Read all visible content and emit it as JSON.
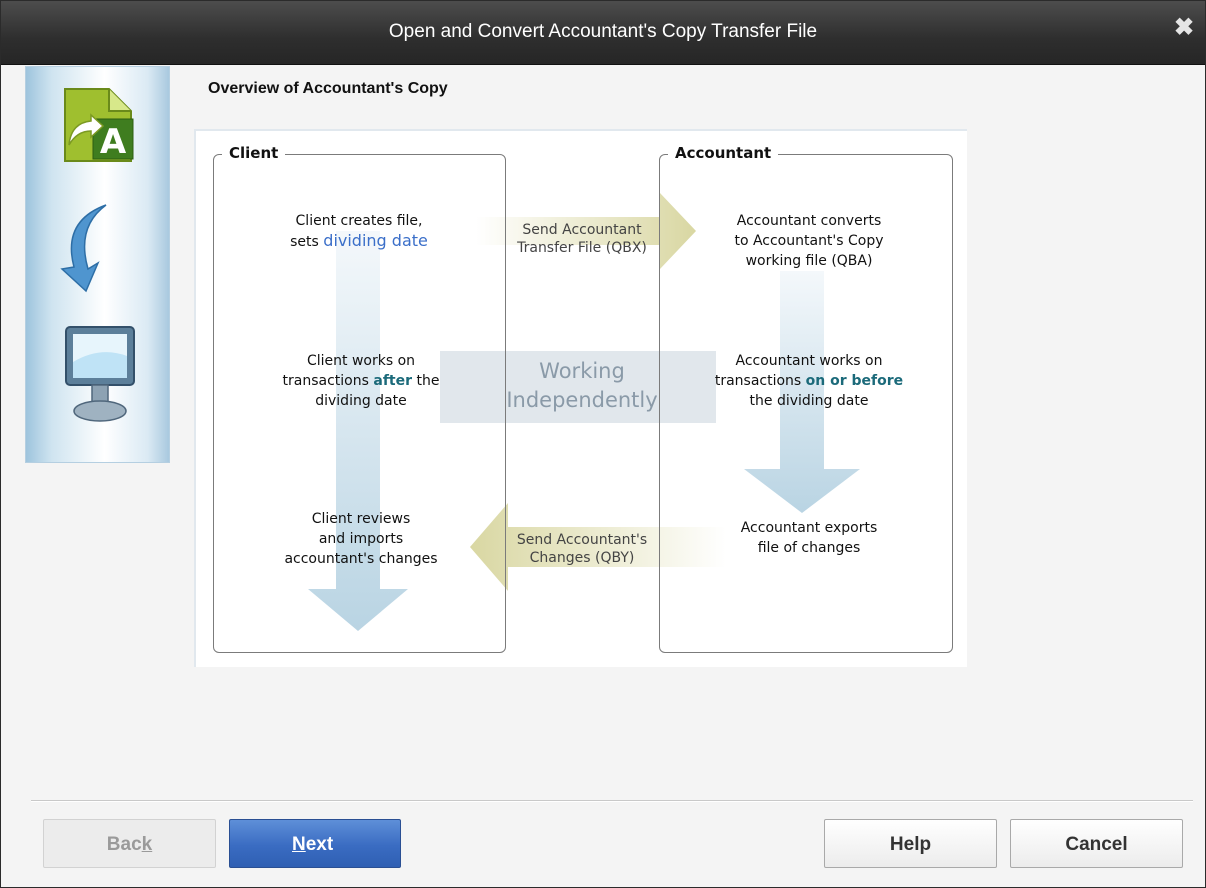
{
  "window": {
    "title": "Open and Convert Accountant's Copy Transfer File",
    "close_glyph": "✖"
  },
  "sidebar": {
    "icons": [
      "accountant-copy-icon",
      "curved-arrow-icon",
      "monitor-icon"
    ]
  },
  "page": {
    "heading": "Overview of Accountant's Copy"
  },
  "diagram": {
    "client": {
      "title": "Client",
      "step1": {
        "line1": "Client creates file,",
        "line2_prefix": "sets ",
        "highlight": "dividing date"
      },
      "step2": {
        "line1": "Client works on",
        "line2_prefix": "transactions ",
        "highlight": "after",
        "line2_suffix": " the",
        "line3": "dividing date"
      },
      "step3": {
        "line1": "Client reviews",
        "line2": "and imports",
        "line3": "accountant's changes"
      }
    },
    "accountant": {
      "title": "Accountant",
      "step1": {
        "line1": "Accountant converts",
        "line2": "to Accountant's Copy",
        "line3": "working file (QBA)"
      },
      "step2": {
        "line1": "Accountant works on",
        "line2_prefix": "transactions ",
        "highlight": "on or before",
        "line3": "the dividing date"
      },
      "step3": {
        "line1": "Accountant exports",
        "line2": "file of changes"
      }
    },
    "send_transfer": {
      "line1": "Send Accountant",
      "line2": "Transfer File (QBX)"
    },
    "working": {
      "line1": "Working",
      "line2": "Independently"
    },
    "send_changes": {
      "line1": "Send Accountant's",
      "line2": "Changes (QBY)"
    }
  },
  "buttons": {
    "back": {
      "pre": "Bac",
      "u": "k",
      "post": ""
    },
    "next": {
      "pre": "",
      "u": "N",
      "post": "ext"
    },
    "help": "Help",
    "cancel": "Cancel"
  },
  "colors": {
    "accent": "#3a6cc2",
    "highlight": "#1b6a7a",
    "link": "#3b6fc9",
    "titlebar": "#333333"
  }
}
